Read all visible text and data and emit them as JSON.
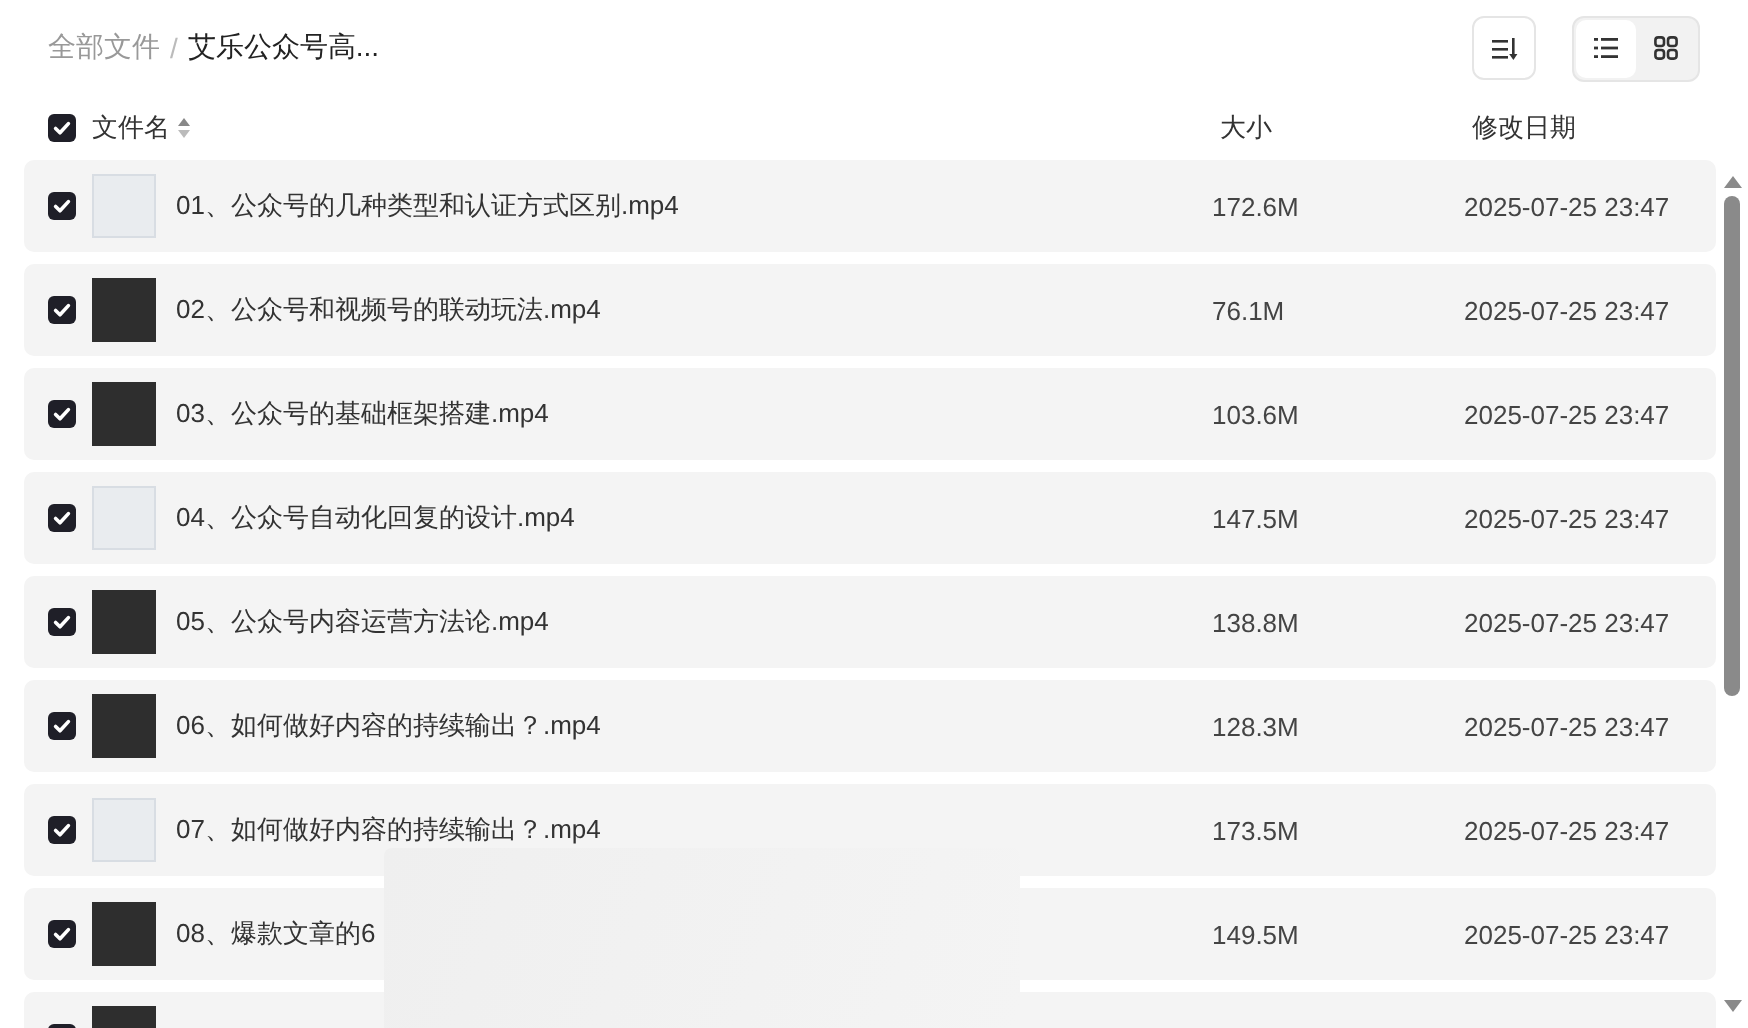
{
  "breadcrumb": [
    {
      "label": "全部文件",
      "current": false
    },
    {
      "label": "艾乐公众号高...",
      "current": true
    }
  ],
  "breadcrumb_separator": "/",
  "view_modes": [
    {
      "kind": "list",
      "selected": true
    },
    {
      "kind": "grid",
      "selected": false
    }
  ],
  "columns": {
    "select_all_checked": true,
    "name": "文件名",
    "size": "大小",
    "modified": "修改日期"
  },
  "rows": [
    {
      "checked": true,
      "name": "01、公众号的几种类型和认证方式区别.mp4",
      "size": "172.6M",
      "modified": "2025-07-25 23:47"
    },
    {
      "checked": true,
      "name": "02、公众号和视频号的联动玩法.mp4",
      "size": "76.1M",
      "modified": "2025-07-25 23:47"
    },
    {
      "checked": true,
      "name": "03、公众号的基础框架搭建.mp4",
      "size": "103.6M",
      "modified": "2025-07-25 23:47"
    },
    {
      "checked": true,
      "name": "04、公众号自动化回复的设计.mp4",
      "size": "147.5M",
      "modified": "2025-07-25 23:47"
    },
    {
      "checked": true,
      "name": "05、公众号内容运营方法论.mp4",
      "size": "138.8M",
      "modified": "2025-07-25 23:47"
    },
    {
      "checked": true,
      "name": "06、如何做好内容的持续输出？.mp4",
      "size": "128.3M",
      "modified": "2025-07-25 23:47"
    },
    {
      "checked": true,
      "name": "07、如何做好内容的持续输出？.mp4",
      "size": "173.5M",
      "modified": "2025-07-25 23:47"
    },
    {
      "checked": true,
      "name": "08、爆款文章的6",
      "size": "149.5M",
      "modified": "2025-07-25 23:47"
    },
    {
      "checked": true
    }
  ]
}
